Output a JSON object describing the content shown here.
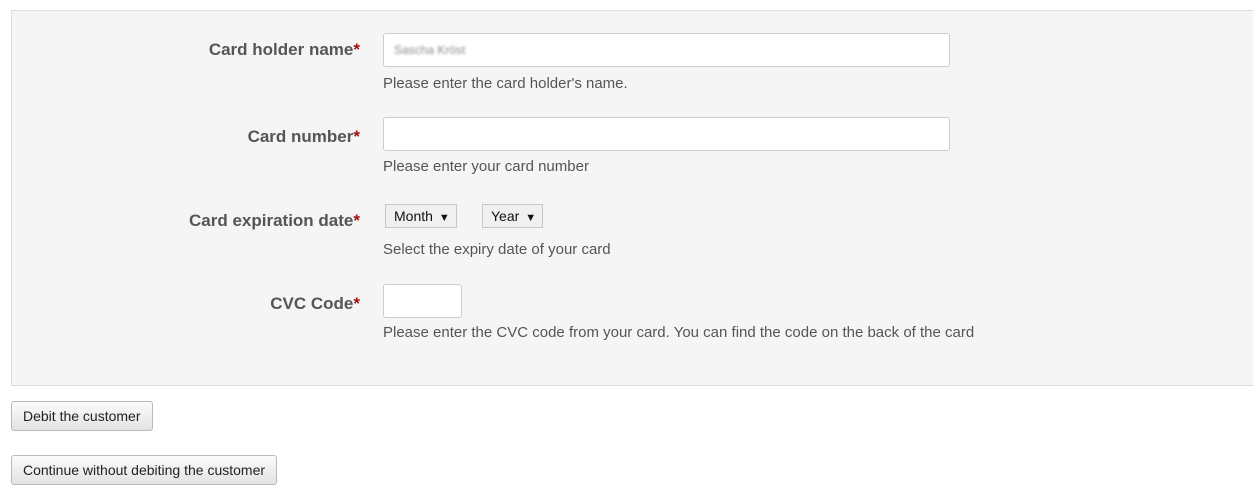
{
  "form": {
    "card_holder": {
      "label": "Card holder name",
      "required_mark": "*",
      "value": "Sascha Kröst",
      "help": "Please enter the card holder's name."
    },
    "card_number": {
      "label": "Card number",
      "required_mark": "*",
      "value": "",
      "help": "Please enter your card number"
    },
    "expiration": {
      "label": "Card expiration date",
      "required_mark": "*",
      "month_selected": "Month",
      "year_selected": "Year",
      "help": "Select the expiry date of your card"
    },
    "cvc": {
      "label": "CVC Code",
      "required_mark": "*",
      "value": "",
      "help": "Please enter the CVC code from your card. You can find the code on the back of the card"
    }
  },
  "actions": {
    "debit_label": "Debit the customer",
    "continue_label": "Continue without debiting the customer"
  },
  "icons": {
    "dropdown": "caret-down-icon"
  }
}
